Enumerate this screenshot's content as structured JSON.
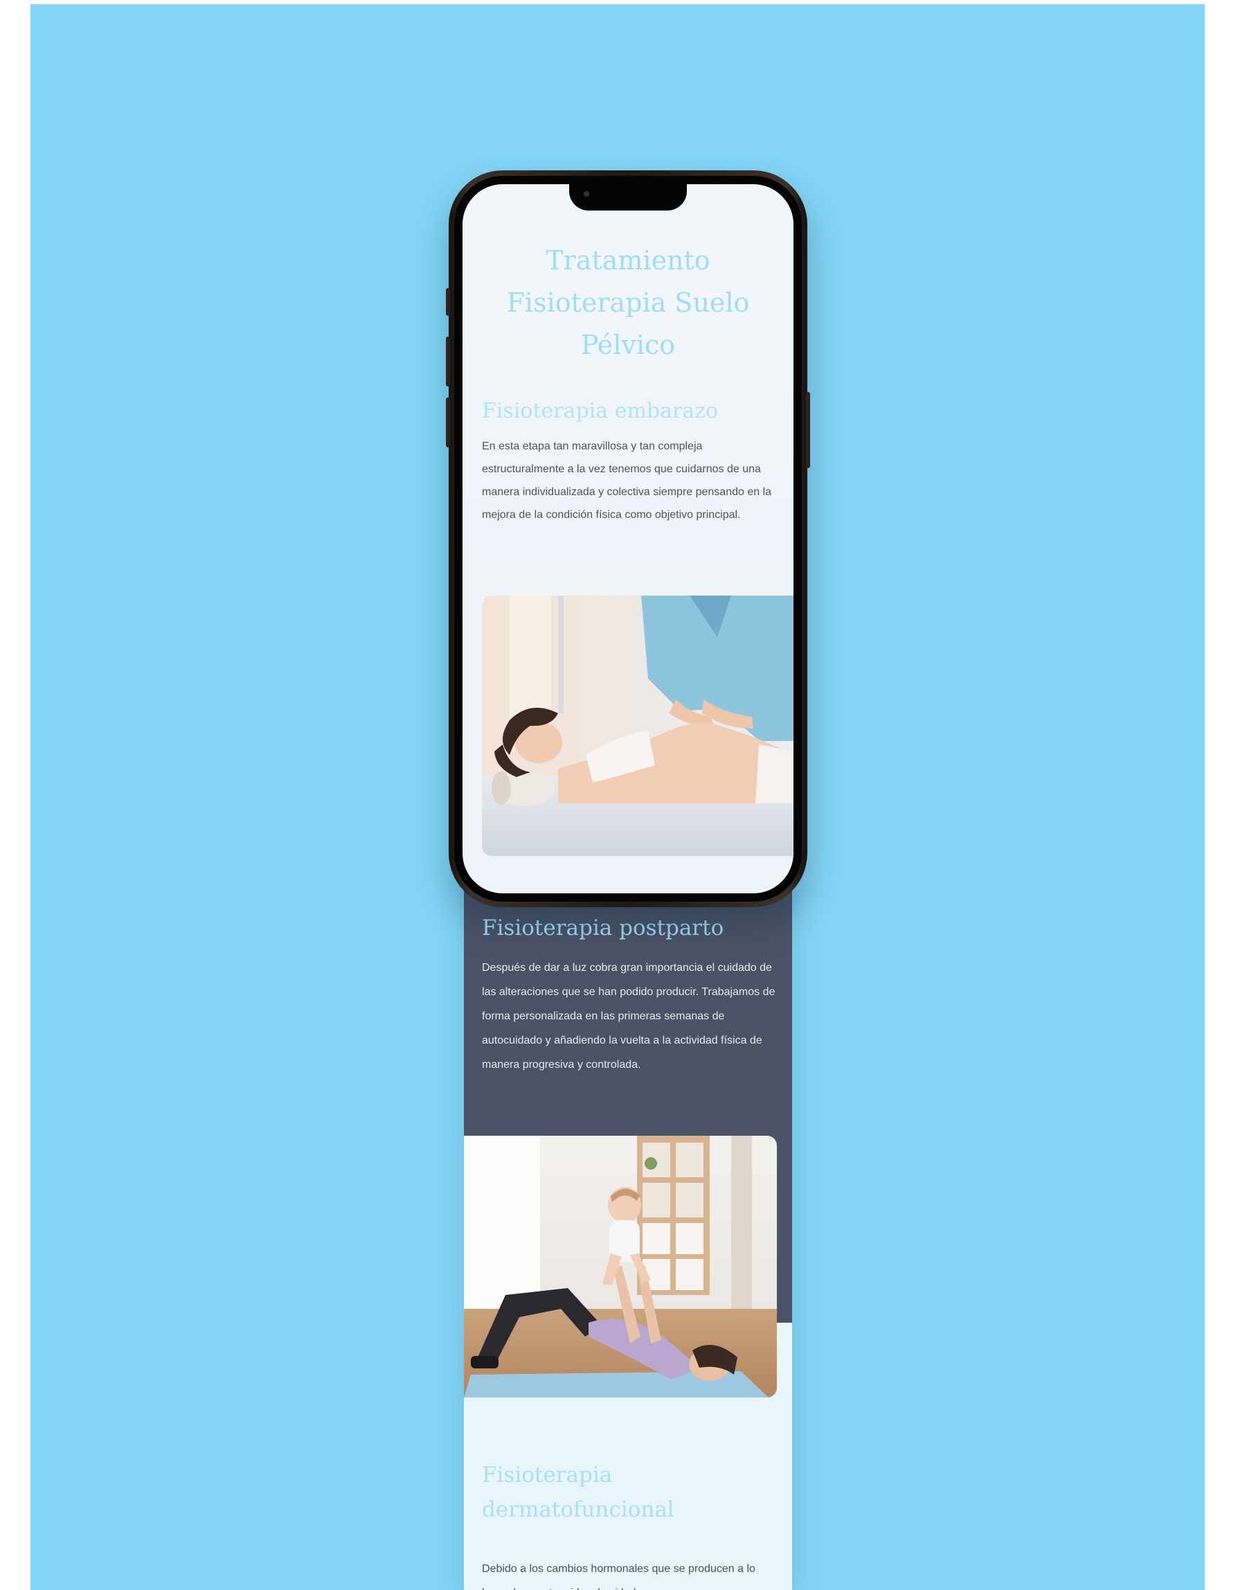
{
  "hero": {
    "title": "Tratamiento Fisioterapia Suelo Pélvico"
  },
  "sections": [
    {
      "title": "Fisioterapia embarazo",
      "body": "En esta etapa tan maravillosa y tan compleja estructuralmente a la vez tenemos que cuidarnos de una manera individualizada y colectiva siempre pensando en la mejora de la condición física como objetivo principal."
    },
    {
      "title": "Fisioterapia postparto",
      "body": "Después de dar a luz cobra gran importancia el cuidado de las alteraciones que se han podido producir. Trabajamos de forma personalizada en las primeras semanas de autocuidado y añadiendo la vuelta a la actividad física de manera progresiva y controlada."
    },
    {
      "title": "Fisioterapia dermatofuncional",
      "body": "Debido a los cambios hormonales que se producen a lo largo de nuestra vida, el cuidado"
    }
  ],
  "colors": {
    "backdrop": "#84d5f6",
    "accent_title": "#9fdcf5",
    "dark_section": "#4b5265",
    "light_section": "#e8f5fb"
  }
}
